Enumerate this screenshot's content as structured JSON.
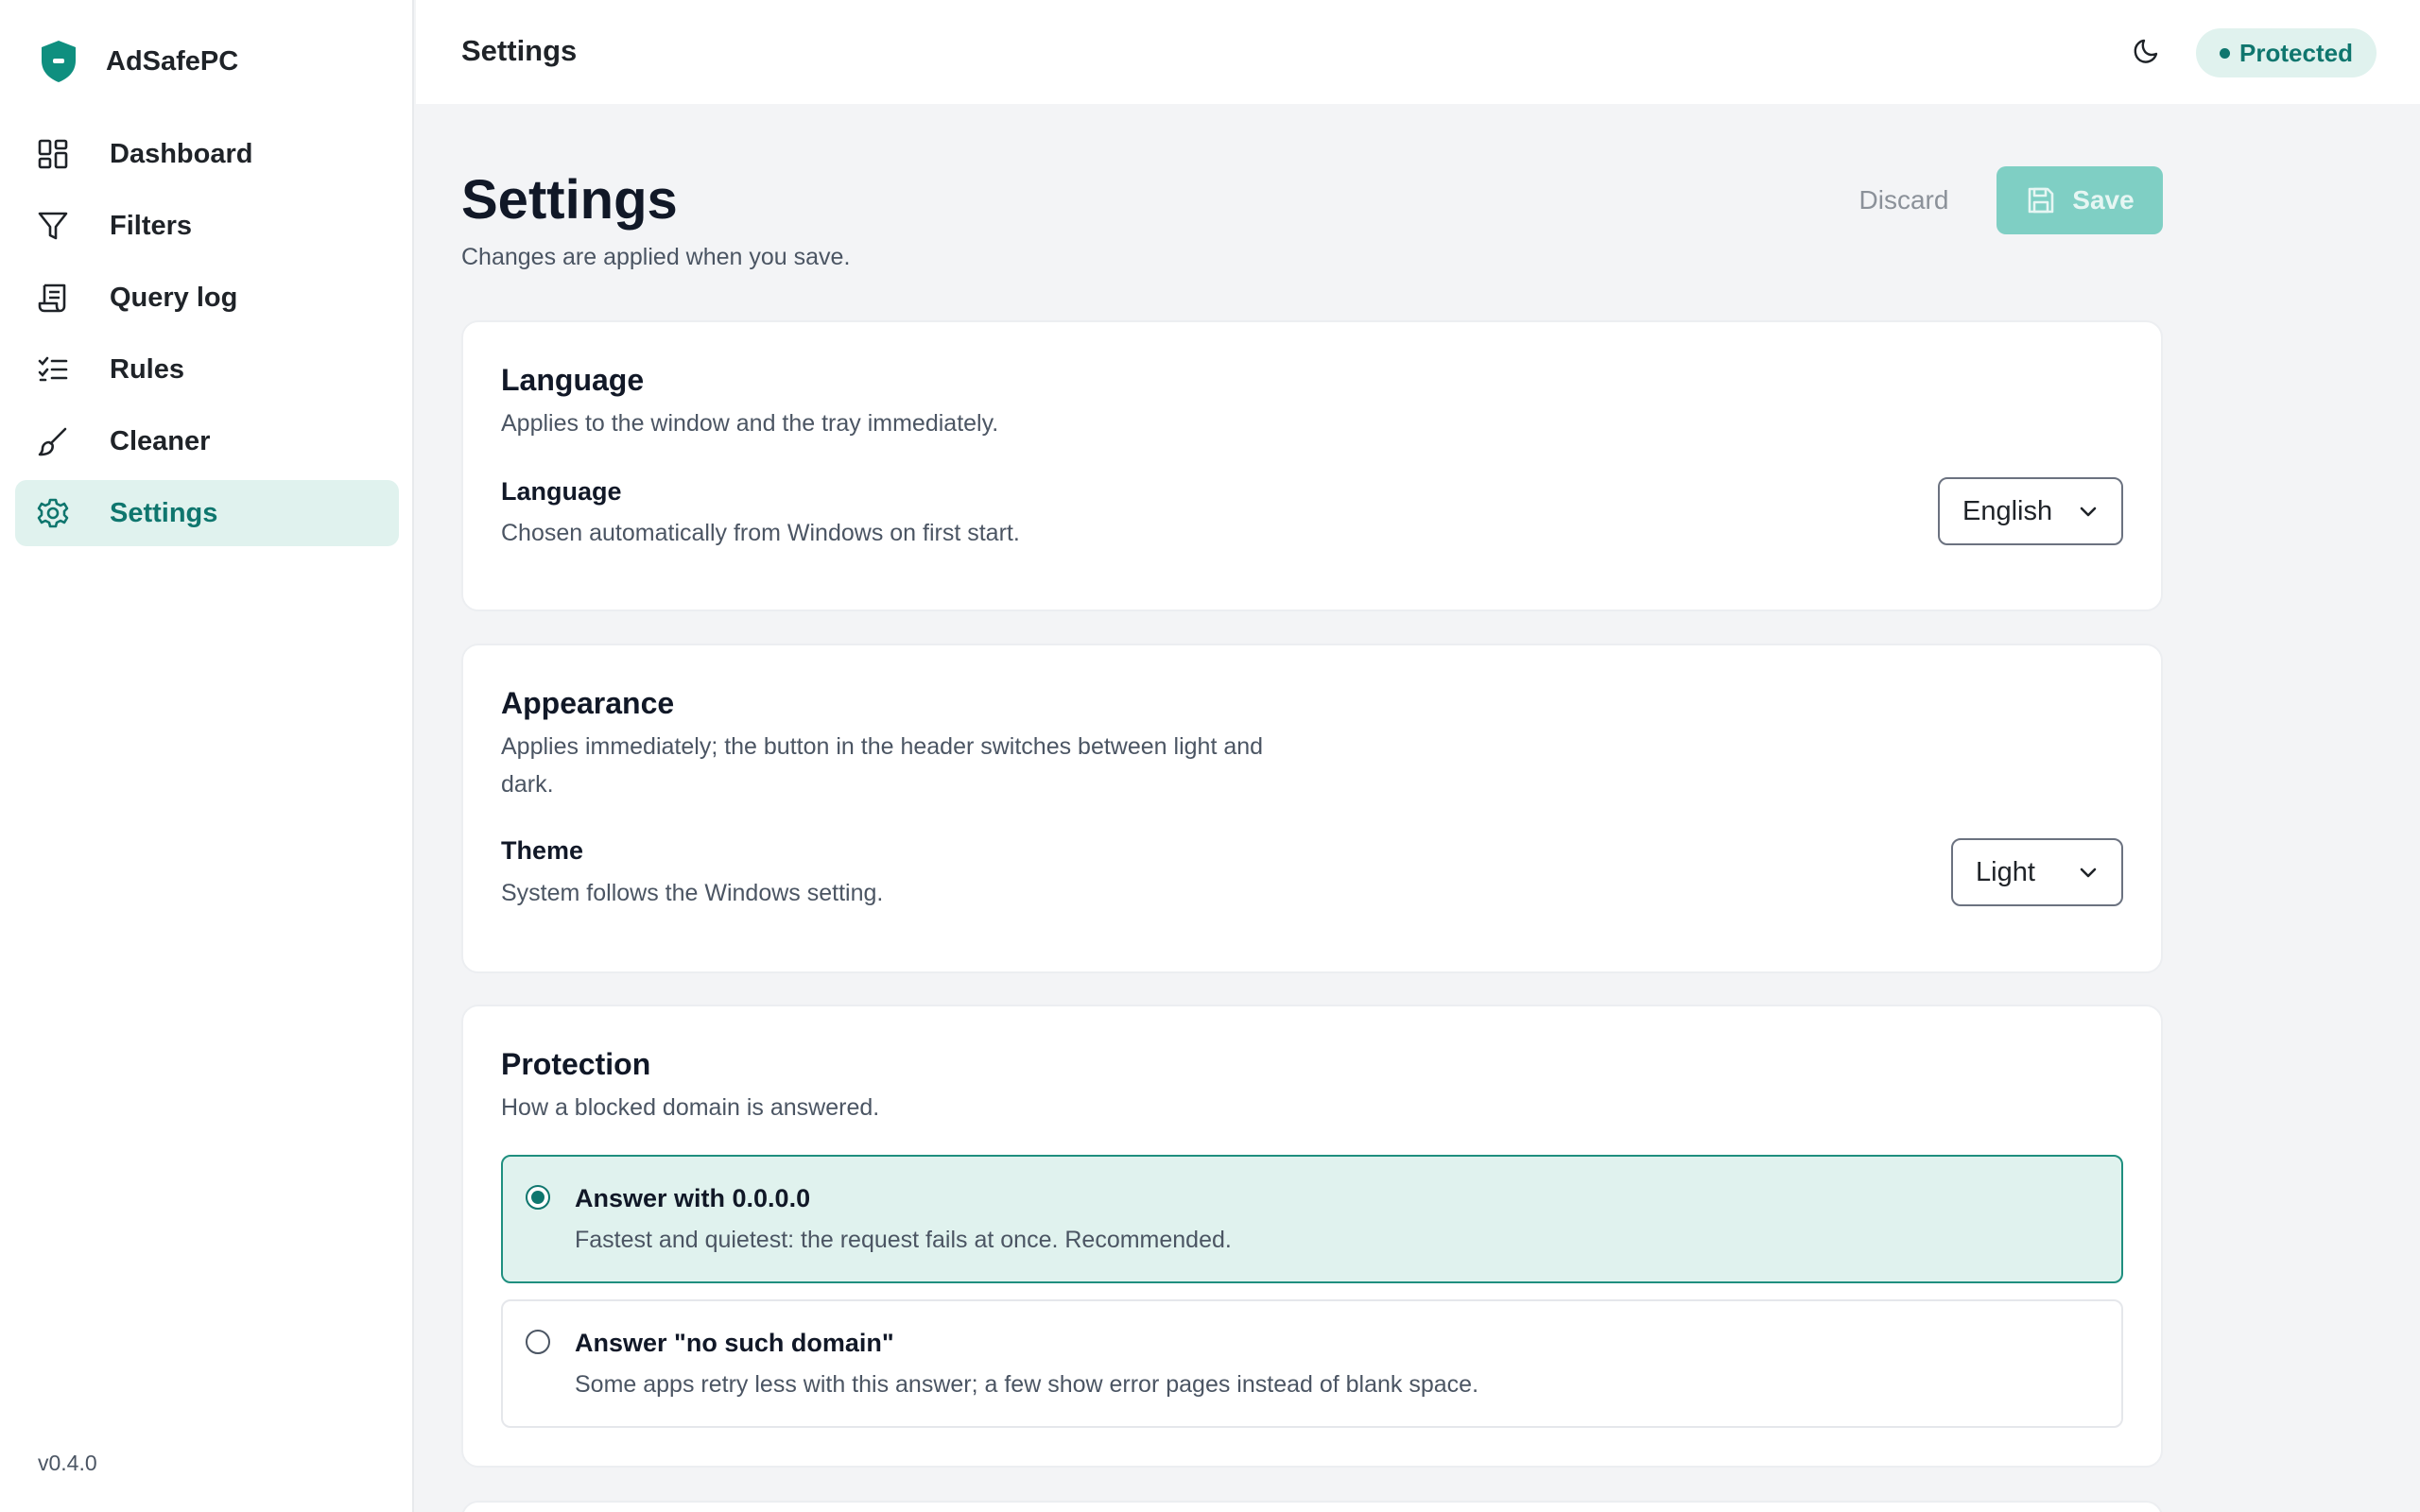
{
  "app": {
    "name": "AdSafePC",
    "version": "v0.4.0"
  },
  "sidebar": {
    "items": [
      {
        "label": "Dashboard",
        "icon": "dashboard-icon"
      },
      {
        "label": "Filters",
        "icon": "filter-icon"
      },
      {
        "label": "Query log",
        "icon": "scroll-icon"
      },
      {
        "label": "Rules",
        "icon": "checklist-icon"
      },
      {
        "label": "Cleaner",
        "icon": "brush-icon"
      },
      {
        "label": "Settings",
        "icon": "gear-icon",
        "active": true
      }
    ]
  },
  "header": {
    "title": "Settings",
    "status": "Protected",
    "theme_icon": "moon-icon"
  },
  "page": {
    "title": "Settings",
    "subtitle": "Changes are applied when you save.",
    "discard_label": "Discard",
    "save_label": "Save"
  },
  "language": {
    "title": "Language",
    "desc": "Applies to the window and the tray immediately.",
    "row_label": "Language",
    "row_help": "Chosen automatically from Windows on first start.",
    "value": "English"
  },
  "appearance": {
    "title": "Appearance",
    "desc_line1": "Applies immediately; the button in the header switches between light and",
    "desc_line2": "dark.",
    "row_label": "Theme",
    "row_help": "System follows the Windows setting.",
    "value": "Light"
  },
  "protection": {
    "title": "Protection",
    "desc": "How a blocked domain is answered.",
    "options": [
      {
        "title": "Answer with 0.0.0.0",
        "desc": "Fastest and quietest: the request fails at once. Recommended.",
        "selected": true
      },
      {
        "title": "Answer \"no such domain\"",
        "desc": "Some apps retry less with this answer; a few show error pages instead of blank space.",
        "selected": false
      }
    ]
  },
  "colors": {
    "accent": "#0f766e",
    "accent_soft": "#e0f2ee",
    "save_disabled": "#7fcfc4"
  }
}
